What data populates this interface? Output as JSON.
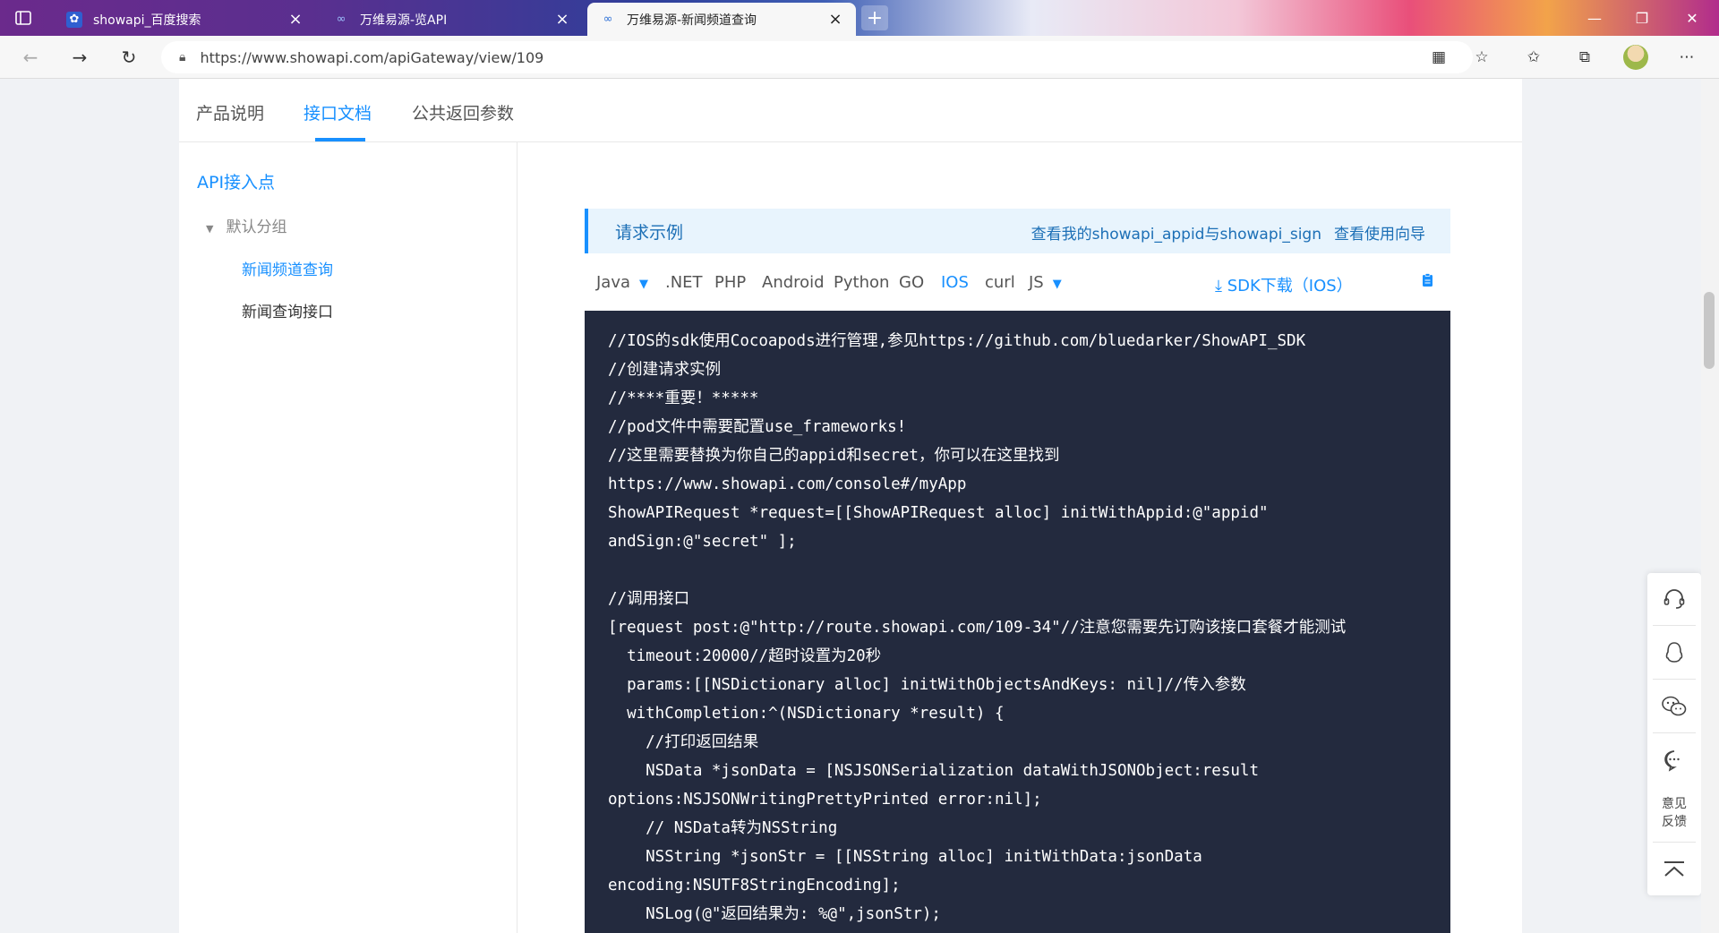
{
  "browser": {
    "tabs": [
      {
        "title": "showapi_百度搜索",
        "icon": "baidu-paw-icon"
      },
      {
        "title": "万维易源-览API",
        "icon": "infinity-icon"
      },
      {
        "title": "万维易源-新闻频道查询",
        "icon": "infinity-icon"
      }
    ],
    "url": "https://www.showapi.com/apiGateway/view/109"
  },
  "top_tabs": [
    "产品说明",
    "接口文档",
    "公共返回参数"
  ],
  "sidebar": {
    "title": "API接入点",
    "group": "默认分组",
    "items": [
      "新闻频道查询",
      "新闻查询接口"
    ]
  },
  "request": {
    "title": "请求示例",
    "link1": "查看我的showapi_appid与showapi_sign",
    "link2": "查看使用向导"
  },
  "languages": [
    "Java",
    ".NET",
    "PHP",
    "Android",
    "Python",
    "GO",
    "IOS",
    "curl",
    "JS"
  ],
  "sdk_download": "SDK下载（IOS）",
  "code": "//IOS的sdk使用Cocoapods进行管理,参见https://github.com/bluedarker/ShowAPI_SDK\n//创建请求实例\n//****重要！*****\n//pod文件中需要配置use_frameworks!\n//这里需要替换为你自己的appid和secret，你可以在这里找到\nhttps://www.showapi.com/console#/myApp\nShowAPIRequest *request=[[ShowAPIRequest alloc] initWithAppid:@\"appid\"\nandSign:@\"secret\" ];\n\n//调用接口\n[request post:@\"http://route.showapi.com/109-34\"//注意您需要先订购该接口套餐才能测试\n  timeout:20000//超时设置为20秒\n  params:[[NSDictionary alloc] initWithObjectsAndKeys: nil]//传入参数\n  withCompletion:^(NSDictionary *result) {\n    //打印返回结果\n    NSData *jsonData = [NSJSONSerialization dataWithJSONObject:result\noptions:NSJSONWritingPrettyPrinted error:nil];\n    // NSData转为NSString\n    NSString *jsonStr = [[NSString alloc] initWithData:jsonData\nencoding:NSUTF8StringEncoding];\n    NSLog(@\"返回结果为: %@\",jsonStr);",
  "feedback": {
    "line1": "意见",
    "line2": "反馈"
  }
}
